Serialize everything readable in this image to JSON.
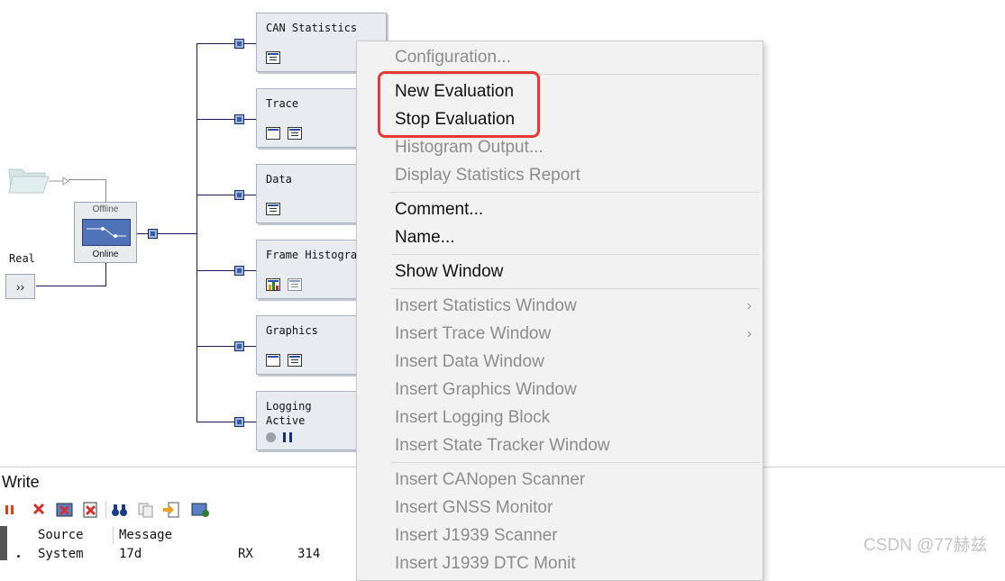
{
  "diagram": {
    "offline_switch": {
      "top_label": "Offline",
      "bottom_label": "Online"
    },
    "real_input": {
      "label": "Real",
      "button_glyph": "››"
    },
    "blocks": [
      {
        "title": "CAN Statistics",
        "icons": [
          "statistics-table-icon"
        ]
      },
      {
        "title": "Trace",
        "icons": [
          "window-icon",
          "list-icon"
        ]
      },
      {
        "title": "Data",
        "icons": [
          "data-window-icon"
        ]
      },
      {
        "title": "Frame Histogra",
        "icons": [
          "histogram-icon",
          "list-icon"
        ]
      },
      {
        "title": "Graphics",
        "icons": [
          "graphics-icon",
          "list-icon"
        ]
      },
      {
        "title": "Logging\nActive",
        "icons": [
          "record-dot-icon",
          "pause-icon"
        ]
      }
    ]
  },
  "context_menu": {
    "items": [
      {
        "label": "Configuration...",
        "enabled": false
      },
      {
        "label": "New Evaluation",
        "enabled": true
      },
      {
        "label": "Stop Evaluation",
        "enabled": true
      },
      {
        "label": "Histogram Output...",
        "enabled": false
      },
      {
        "label": "Display Statistics Report",
        "enabled": false
      },
      {
        "label": "Comment...",
        "enabled": true
      },
      {
        "label": "Name...",
        "enabled": true
      },
      {
        "label": "Show Window",
        "enabled": true
      },
      {
        "label": "Insert Statistics Window",
        "enabled": false,
        "submenu": true
      },
      {
        "label": "Insert Trace Window",
        "enabled": false,
        "submenu": true
      },
      {
        "label": "Insert Data Window",
        "enabled": false
      },
      {
        "label": "Insert Graphics Window",
        "enabled": false
      },
      {
        "label": "Insert Logging Block",
        "enabled": false
      },
      {
        "label": "Insert State Tracker Window",
        "enabled": false
      },
      {
        "label": "Insert CANopen Scanner",
        "enabled": false
      },
      {
        "label": "Insert GNSS Monitor",
        "enabled": false
      },
      {
        "label": "Insert J1939 Scanner",
        "enabled": false
      },
      {
        "label": "Insert J1939 DTC Monit",
        "enabled": false
      }
    ],
    "highlight_color": "#e53935"
  },
  "write_panel": {
    "title": "Write",
    "columns": [
      "Source",
      "Message"
    ],
    "row": {
      "source": "System",
      "message": "17d",
      "rx": "RX",
      "count": "314"
    }
  },
  "watermark": "CSDN @77赫兹",
  "colors": {
    "block_bg": "#e8ecf1",
    "junction": "#3a5da8",
    "menu_bg": "#f2f2f2"
  }
}
